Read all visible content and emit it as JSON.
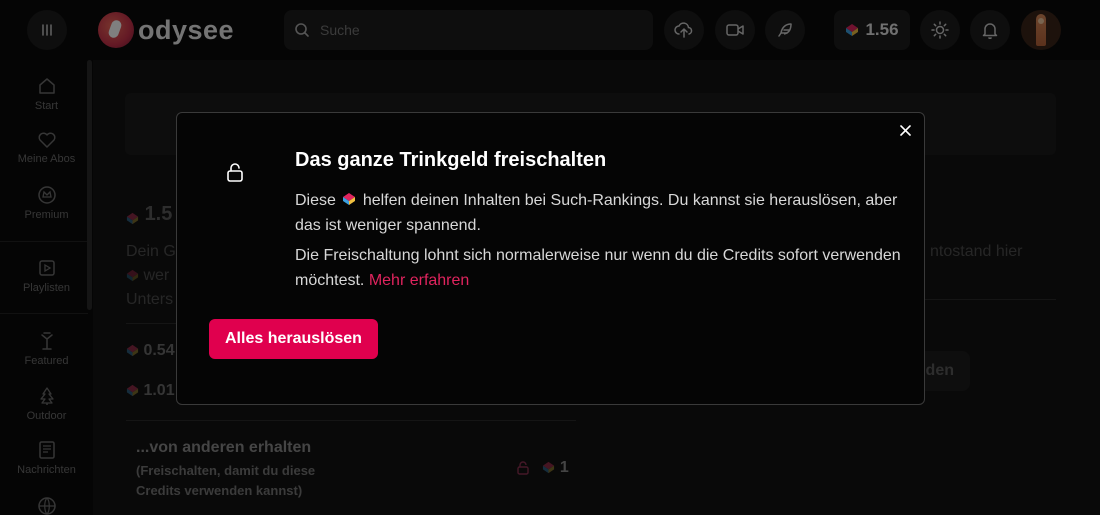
{
  "header": {
    "logo_text": "odysee",
    "search_placeholder": "Suche",
    "wallet_balance": "1.56"
  },
  "sidebar": {
    "items": [
      {
        "label": "Start",
        "icon": "home-icon"
      },
      {
        "label": "Meine Abos",
        "icon": "heart-icon"
      },
      {
        "label": "Premium",
        "icon": "premium-icon"
      },
      {
        "label": "Playlisten",
        "icon": "playlist-icon"
      },
      {
        "label": "Featured",
        "icon": "featured-icon"
      },
      {
        "label": "Outdoor",
        "icon": "tree-icon"
      },
      {
        "label": "Nachrichten",
        "icon": "news-icon"
      }
    ]
  },
  "background": {
    "balance_partial": "1.5",
    "intro_partial_1": "Dein G",
    "intro_partial_2": "wer",
    "intro_partial_3": "Unters",
    "value_1": "0.54",
    "value_2": "1.01",
    "right_partial": "ntostand hier",
    "right_button_partial": "den",
    "received_title": "...von anderen erhalten",
    "received_sub": "(Freischalten, damit du diese Credits verwenden kannst)",
    "received_amount": "1"
  },
  "modal": {
    "title": "Das ganze Trinkgeld freischalten",
    "p1_before": "Diese",
    "p1_after": "helfen deinen Inhalten bei Such-Rankings. Du kannst sie herauslösen, aber das ist weniger spannend.",
    "p2_text": "Die Freischaltung lohnt sich normalerweise nur wenn du die Credits sofort verwenden möchtest.",
    "p2_link": "Mehr erfahren",
    "button": "Alles herauslösen"
  },
  "colors": {
    "accent": "#e0004e",
    "link": "#e0245e",
    "background": "#0b0b0b"
  }
}
